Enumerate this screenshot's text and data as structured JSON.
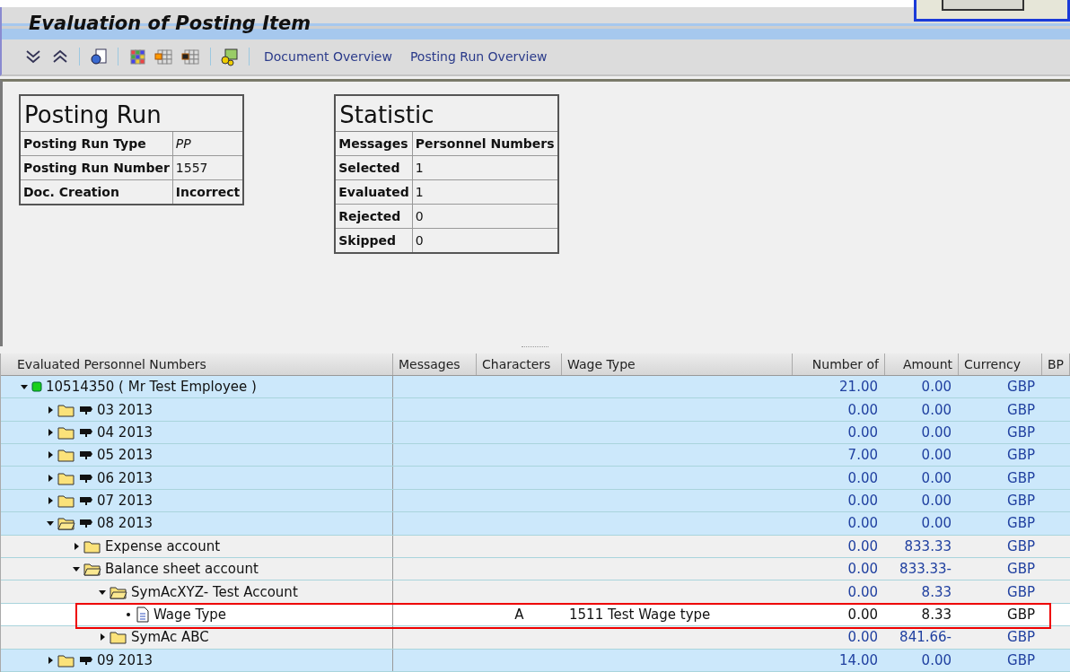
{
  "window": {
    "title": "Evaluation of Posting Item"
  },
  "toolbar": {
    "links": [
      "Document Overview",
      "Posting Run Overview"
    ]
  },
  "posting_run": {
    "title": "Posting Run",
    "rows": [
      {
        "label": "Posting Run Type",
        "value": "PP",
        "italic": true,
        "bold": false
      },
      {
        "label": "Posting Run Number",
        "value": "1557",
        "italic": false,
        "bold": false
      },
      {
        "label": "Doc. Creation",
        "value": "Incorrect",
        "italic": false,
        "bold": true
      }
    ]
  },
  "statistic": {
    "title": "Statistic",
    "header": [
      "Messages",
      "Personnel Numbers"
    ],
    "rows": [
      {
        "label": "Selected",
        "value": "1"
      },
      {
        "label": "Evaluated",
        "value": "1"
      },
      {
        "label": "Rejected",
        "value": "0"
      },
      {
        "label": "Skipped",
        "value": "0"
      }
    ]
  },
  "table": {
    "columns": [
      "Evaluated Personnel Numbers",
      "Messages",
      "Characters",
      "Wage Type",
      "Number of",
      "Amount",
      "Currency",
      "BP"
    ],
    "rows": [
      {
        "kind": "employee",
        "label": "10514350 ( Mr Test Employee )",
        "expanded": true,
        "number": "21.00",
        "amount": "0.00",
        "currency": "GBP",
        "children": [
          {
            "kind": "period",
            "label": "03 2013",
            "expanded": false,
            "number": "0.00",
            "amount": "0.00",
            "currency": "GBP"
          },
          {
            "kind": "period",
            "label": "04 2013",
            "expanded": false,
            "number": "0.00",
            "amount": "0.00",
            "currency": "GBP"
          },
          {
            "kind": "period",
            "label": "05 2013",
            "expanded": false,
            "number": "7.00",
            "amount": "0.00",
            "currency": "GBP"
          },
          {
            "kind": "period",
            "label": "06 2013",
            "expanded": false,
            "number": "0.00",
            "amount": "0.00",
            "currency": "GBP"
          },
          {
            "kind": "period",
            "label": "07 2013",
            "expanded": false,
            "number": "0.00",
            "amount": "0.00",
            "currency": "GBP"
          },
          {
            "kind": "period",
            "label": "08 2013",
            "expanded": true,
            "number": "0.00",
            "amount": "0.00",
            "currency": "GBP",
            "children": [
              {
                "kind": "folder",
                "label": "Expense account",
                "expanded": false,
                "number": "0.00",
                "amount": "833.33",
                "currency": "GBP"
              },
              {
                "kind": "folder",
                "label": "Balance sheet account",
                "expanded": true,
                "number": "0.00",
                "amount": "833.33-",
                "currency": "GBP",
                "children": [
                  {
                    "kind": "folder",
                    "label": "SymAcXYZ- Test Account",
                    "expanded": true,
                    "number": "0.00",
                    "amount": "8.33",
                    "currency": "GBP",
                    "children": [
                      {
                        "kind": "item",
                        "label": "Wage Type",
                        "highlighted": true,
                        "characters": "A",
                        "wage_type": "1511 Test Wage type",
                        "number": "0.00",
                        "amount": "8.33",
                        "currency": "GBP"
                      }
                    ]
                  },
                  {
                    "kind": "folder",
                    "label": "SymAc   ABC",
                    "expanded": false,
                    "number": "0.00",
                    "amount": "841.66-",
                    "currency": "GBP"
                  }
                ]
              }
            ]
          },
          {
            "kind": "period",
            "label": "09 2013",
            "expanded": false,
            "number": "14.00",
            "amount": "0.00",
            "currency": "GBP"
          }
        ]
      }
    ]
  }
}
